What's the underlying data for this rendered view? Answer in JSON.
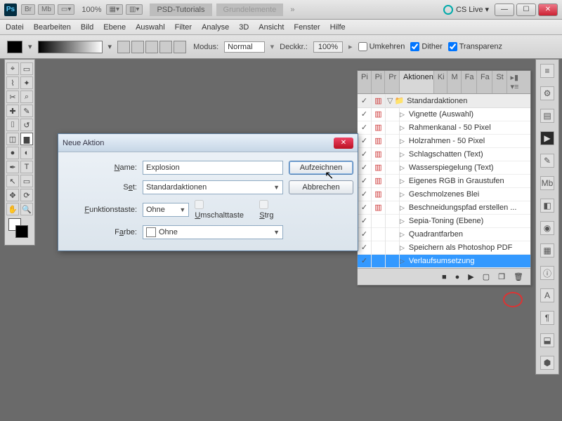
{
  "titlebar": {
    "zoom": "100%",
    "tab1": "PSD-Tutorials",
    "tab2": "Grundelemente",
    "cslive": "CS Live"
  },
  "menu": [
    "Datei",
    "Bearbeiten",
    "Bild",
    "Ebene",
    "Auswahl",
    "Filter",
    "Analyse",
    "3D",
    "Ansicht",
    "Fenster",
    "Hilfe"
  ],
  "options": {
    "modus_label": "Modus:",
    "modus_value": "Normal",
    "deckkr_label": "Deckkr.:",
    "deckkr_value": "100%",
    "umkehren": "Umkehren",
    "dither": "Dither",
    "transparenz": "Transparenz"
  },
  "panel": {
    "tabs": [
      "Pi",
      "Pi",
      "Pr",
      "Aktionen",
      "Ki",
      "M",
      "Fa",
      "Fa",
      "St"
    ],
    "folder": "Standardaktionen",
    "actions": [
      "Vignette (Auswahl)",
      "Rahmenkanal - 50 Pixel",
      "Holzrahmen - 50 Pixel",
      "Schlagschatten (Text)",
      "Wasserspiegelung (Text)",
      "Eigenes RGB in Graustufen",
      "Geschmolzenes Blei",
      "Beschneidungspfad erstellen ...",
      "Sepia-Toning (Ebene)",
      "Quadrantfarben",
      "Speichern als Photoshop PDF",
      "Verlaufsumsetzung"
    ],
    "selected": 11
  },
  "dialog": {
    "title": "Neue Aktion",
    "name_label": "Name:",
    "name_value": "Explosion",
    "set_label": "Set:",
    "set_value": "Standardaktionen",
    "fkey_label": "Funktionstaste:",
    "fkey_value": "Ohne",
    "shift": "Umschalttaste",
    "ctrl": "Strg",
    "color_label": "Farbe:",
    "color_value": "Ohne",
    "record": "Aufzeichnen",
    "cancel": "Abbrechen"
  }
}
